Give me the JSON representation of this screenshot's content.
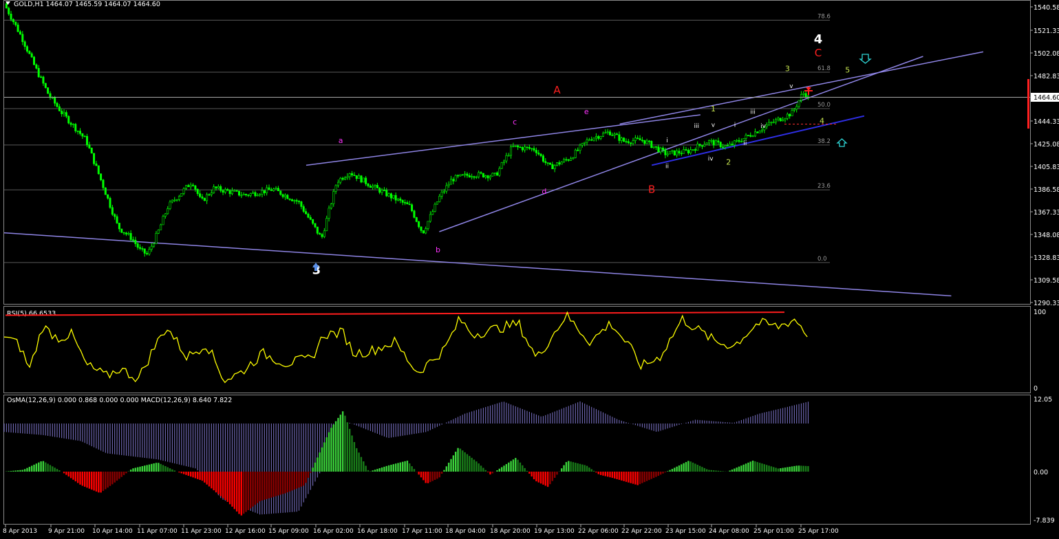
{
  "header": {
    "symbol_line": "GOLD,H1  1464.07 1465.59 1464.07 1464.60"
  },
  "colors": {
    "background": "#000000",
    "grid": "#5a5a5a",
    "candle": "#00ff00",
    "trendline": "#8f85e6",
    "trendline_dark": "#2f2fe8",
    "rsi_line": "#ffff00",
    "rsi_level": "#ff1d1d",
    "macd_line": "#8f85e6",
    "osma_up": "#3ad23a",
    "osma_down": "#ff0000",
    "osma_dark_down": "#8b0000",
    "osma_dark_up": "#197c19",
    "price_tag_bg": "#ffffff",
    "price_tag_fg": "#000000",
    "cursor_marker": "#ff0000"
  },
  "price_axis": {
    "ticks": [
      "1540.58",
      "1521.33",
      "1502.08",
      "1482.83",
      "1464.60",
      "1444.33",
      "1425.08",
      "1405.83",
      "1386.58",
      "1367.33",
      "1348.08",
      "1328.83",
      "1309.58",
      "1290.33"
    ],
    "current_price": "1464.60"
  },
  "time_axis": {
    "ticks": [
      "8 Apr 2013",
      "9 Apr 21:00",
      "10 Apr 14:00",
      "11 Apr 07:00",
      "11 Apr 23:00",
      "12 Apr 16:00",
      "15 Apr 09:00",
      "16 Apr 02:00",
      "16 Apr 18:00",
      "17 Apr 11:00",
      "18 Apr 04:00",
      "18 Apr 20:00",
      "19 Apr 13:00",
      "22 Apr 06:00",
      "22 Apr 22:00",
      "23 Apr 15:00",
      "24 Apr 08:00",
      "25 Apr 01:00",
      "25 Apr 17:00"
    ]
  },
  "fibonacci": {
    "levels": [
      {
        "label": "78.6",
        "price": 1530.6
      },
      {
        "label": "61.8",
        "price": 1485.2
      },
      {
        "label": "50.0",
        "price": 1453.4
      },
      {
        "label": "38.2",
        "price": 1421.7
      },
      {
        "label": "23.6",
        "price": 1382.5
      },
      {
        "label": "0.0",
        "price": 1319.1
      }
    ]
  },
  "wave_labels": [
    {
      "text": "3",
      "color": "#ffffff",
      "time": 24.4,
      "price": 1309.0,
      "size": "large"
    },
    {
      "text": "4",
      "color": "#ffffff",
      "time": 63.6,
      "price": 1510.5,
      "size": "large"
    },
    {
      "text": "C",
      "color": "#ff2020",
      "time": 63.6,
      "price": 1499.0,
      "size": "medium"
    },
    {
      "text": "A",
      "color": "#ff2020",
      "time": 43.2,
      "price": 1466.5,
      "size": "medium"
    },
    {
      "text": "B",
      "color": "#ff2020",
      "time": 50.6,
      "price": 1380.0,
      "size": "medium"
    },
    {
      "text": "a",
      "color": "#ff33ff",
      "time": 26.3,
      "price": 1423.5,
      "size": "small"
    },
    {
      "text": "b",
      "color": "#ff33ff",
      "time": 33.9,
      "price": 1328.0,
      "size": "small"
    },
    {
      "text": "c",
      "color": "#ff33ff",
      "time": 39.9,
      "price": 1439.5,
      "size": "small"
    },
    {
      "text": "d",
      "color": "#ff33ff",
      "time": 42.2,
      "price": 1379.0,
      "size": "small"
    },
    {
      "text": "e",
      "color": "#ff33ff",
      "time": 45.5,
      "price": 1448.5,
      "size": "small"
    },
    {
      "text": "1",
      "color": "#c8e650",
      "time": 55.4,
      "price": 1451.0,
      "size": "small"
    },
    {
      "text": "2",
      "color": "#c8e650",
      "time": 56.6,
      "price": 1404.5,
      "size": "small"
    },
    {
      "text": "3",
      "color": "#c8e650",
      "time": 61.2,
      "price": 1486.0,
      "size": "small"
    },
    {
      "text": "4",
      "color": "#c8e650",
      "time": 63.9,
      "price": 1440.5,
      "size": "small"
    },
    {
      "text": "5",
      "color": "#c8e650",
      "time": 65.9,
      "price": 1485.0,
      "size": "small"
    },
    {
      "text": "i",
      "color": "#ffffff",
      "time": 51.8,
      "price": 1424.0,
      "size": "tiny"
    },
    {
      "text": "ii",
      "color": "#ffffff",
      "time": 51.8,
      "price": 1401.5,
      "size": "tiny"
    },
    {
      "text": "iii",
      "color": "#ffffff",
      "time": 54.1,
      "price": 1436.5,
      "size": "tiny"
    },
    {
      "text": "iv",
      "color": "#ffffff",
      "time": 55.2,
      "price": 1408.0,
      "size": "tiny"
    },
    {
      "text": "v",
      "color": "#ffffff",
      "time": 55.4,
      "price": 1437.5,
      "size": "tiny"
    },
    {
      "text": "i",
      "color": "#ffffff",
      "time": 57.1,
      "price": 1437.5,
      "size": "tiny"
    },
    {
      "text": "ii",
      "color": "#ffffff",
      "time": 57.9,
      "price": 1421.5,
      "size": "tiny"
    },
    {
      "text": "iii",
      "color": "#ffffff",
      "time": 58.5,
      "price": 1449.0,
      "size": "tiny"
    },
    {
      "text": "iv",
      "color": "#ffffff",
      "time": 59.3,
      "price": 1436.5,
      "size": "tiny"
    },
    {
      "text": "v",
      "color": "#ffffff",
      "time": 61.5,
      "price": 1471.5,
      "size": "tiny"
    }
  ],
  "rsi_panel": {
    "label": "RSI(5) 66.6533",
    "scale_max": "100",
    "scale_min": "0"
  },
  "osma_panel": {
    "label": "OsMA(12,26,9) 0.000 0.868 0.000 0.000  MACD(12,26,9) 8.640 7.822",
    "scale_top": "12.05",
    "scale_mid": "0.00",
    "scale_bottom": "-7.839"
  },
  "chart_data": {
    "type": "candlestick",
    "title": "GOLD,H1",
    "x_unit": "bars since 8 Apr 2013 (1 bar = 1 hour)",
    "ylim": [
      1283,
      1547
    ],
    "ohlc_current": {
      "open": 1464.07,
      "high": 1465.59,
      "low": 1464.07,
      "close": 1464.6
    },
    "close_path": [
      [
        0,
        1545
      ],
      [
        1.4,
        1515
      ],
      [
        2.4,
        1490
      ],
      [
        3.5,
        1465
      ],
      [
        4.5,
        1450
      ],
      [
        6.4,
        1426
      ],
      [
        7.6,
        1390
      ],
      [
        8.9,
        1350
      ],
      [
        10.0,
        1340
      ],
      [
        10.6,
        1330
      ],
      [
        11.2,
        1326
      ],
      [
        12.0,
        1345
      ],
      [
        12.8,
        1368
      ],
      [
        14.7,
        1390
      ],
      [
        15.4,
        1372
      ],
      [
        16.4,
        1384
      ],
      [
        18.8,
        1378
      ],
      [
        21.0,
        1383
      ],
      [
        23.0,
        1372
      ],
      [
        24.8,
        1340
      ],
      [
        26.0,
        1390
      ],
      [
        27.0,
        1398
      ],
      [
        28.7,
        1386
      ],
      [
        30.5,
        1375
      ],
      [
        31.7,
        1368
      ],
      [
        32.7,
        1345
      ],
      [
        34.0,
        1376
      ],
      [
        35.0,
        1392
      ],
      [
        36.5,
        1396
      ],
      [
        38.4,
        1395
      ],
      [
        39.7,
        1420
      ],
      [
        41.5,
        1418
      ],
      [
        42.6,
        1402
      ],
      [
        44.2,
        1410
      ],
      [
        45.7,
        1427
      ],
      [
        47.3,
        1433
      ],
      [
        48.4,
        1425
      ],
      [
        49.9,
        1426
      ],
      [
        51.7,
        1414
      ],
      [
        53.4,
        1416
      ],
      [
        55.0,
        1425
      ],
      [
        56.5,
        1420
      ],
      [
        58.2,
        1430
      ],
      [
        59.8,
        1440
      ],
      [
        61.6,
        1450
      ],
      [
        62.4,
        1467
      ],
      [
        62.9,
        1465
      ]
    ],
    "trendlines": [
      {
        "name": "lower channel",
        "from": [
          0,
          1345
        ],
        "to": [
          74,
          1290
        ]
      },
      {
        "name": "a-c-e line",
        "from": [
          23.6,
          1404
        ],
        "to": [
          54.4,
          1448
        ]
      },
      {
        "name": "b-d line",
        "from": [
          34.0,
          1346
        ],
        "to": [
          71.8,
          1499
        ]
      },
      {
        "name": "upper channel",
        "from": [
          48.1,
          1440
        ],
        "to": [
          76.5,
          1503
        ]
      },
      {
        "name": "wave-4 support",
        "from": [
          50.6,
          1404
        ],
        "to": [
          67.2,
          1447
        ],
        "color": "dark"
      }
    ],
    "rsi": {
      "period": 5,
      "last": 66.6533,
      "ylim": [
        0,
        100
      ],
      "path": [
        [
          0,
          70
        ],
        [
          1.2,
          55
        ],
        [
          2.0,
          25
        ],
        [
          3.0,
          80
        ],
        [
          4.2,
          65
        ],
        [
          5.3,
          70
        ],
        [
          6.4,
          30
        ],
        [
          8.0,
          15
        ],
        [
          9.0,
          25
        ],
        [
          10.5,
          12
        ],
        [
          11.8,
          55
        ],
        [
          12.7,
          80
        ],
        [
          14.3,
          40
        ],
        [
          15.8,
          58
        ],
        [
          17.2,
          10
        ],
        [
          18.5,
          20
        ],
        [
          20.2,
          45
        ],
        [
          22.0,
          32
        ],
        [
          24.0,
          38
        ],
        [
          25.0,
          70
        ],
        [
          26.5,
          72
        ],
        [
          27.3,
          45
        ],
        [
          28.6,
          48
        ],
        [
          30.5,
          60
        ],
        [
          32.3,
          20
        ],
        [
          34.4,
          50
        ],
        [
          35.6,
          90
        ],
        [
          36.6,
          70
        ],
        [
          38.6,
          78
        ],
        [
          40.2,
          84
        ],
        [
          41.6,
          38
        ],
        [
          43.9,
          95
        ],
        [
          45.8,
          60
        ],
        [
          47.4,
          85
        ],
        [
          48.8,
          55
        ],
        [
          49.8,
          28
        ],
        [
          51.2,
          40
        ],
        [
          53.0,
          90
        ],
        [
          55.6,
          60
        ],
        [
          57.0,
          55
        ],
        [
          58.9,
          85
        ],
        [
          60.5,
          80
        ],
        [
          61.8,
          90
        ],
        [
          62.9,
          67
        ]
      ]
    },
    "macd": {
      "fast": 12,
      "slow": 26,
      "signal": 9,
      "macd_last": 8.64,
      "signal_last": 7.822,
      "ylim": [
        -7.839,
        12.05
      ],
      "macd_path": [
        [
          0,
          6.5
        ],
        [
          3.0,
          6.0
        ],
        [
          6.0,
          5.0
        ],
        [
          8.0,
          3.0
        ],
        [
          12.0,
          2.0
        ],
        [
          15.0,
          0.5
        ],
        [
          17.0,
          -4.5
        ],
        [
          20.0,
          -7.0
        ],
        [
          23.0,
          -6.5
        ],
        [
          25.0,
          1.0
        ],
        [
          27.0,
          8.0
        ],
        [
          30.0,
          5.5
        ],
        [
          33.0,
          6.5
        ],
        [
          36.0,
          9.5
        ],
        [
          39.0,
          11.5
        ],
        [
          42.0,
          9.0
        ],
        [
          45.0,
          11.5
        ],
        [
          48.0,
          8.5
        ],
        [
          51.0,
          6.5
        ],
        [
          54.0,
          8.5
        ],
        [
          57.0,
          8.0
        ],
        [
          59.0,
          9.5
        ],
        [
          61.0,
          10.5
        ],
        [
          62.9,
          11.5
        ]
      ],
      "osma_path": [
        [
          0,
          0.0
        ],
        [
          1.5,
          0.3
        ],
        [
          3.0,
          1.8
        ],
        [
          4.5,
          0.0
        ],
        [
          6.0,
          -2.2
        ],
        [
          7.5,
          -3.5
        ],
        [
          8.5,
          -2.0
        ],
        [
          10.0,
          0.5
        ],
        [
          12.0,
          1.5
        ],
        [
          13.5,
          0.0
        ],
        [
          15.5,
          -1.5
        ],
        [
          17.5,
          -5.0
        ],
        [
          18.5,
          -7.2
        ],
        [
          20.0,
          -4.8
        ],
        [
          22.0,
          -3.5
        ],
        [
          23.5,
          -2.2
        ],
        [
          25.5,
          7.0
        ],
        [
          26.5,
          10.0
        ],
        [
          27.5,
          4.0
        ],
        [
          28.5,
          0.0
        ],
        [
          30.0,
          1.0
        ],
        [
          31.5,
          1.8
        ],
        [
          33.0,
          -2.0
        ],
        [
          34.0,
          -1.0
        ],
        [
          35.5,
          4.0
        ],
        [
          37.0,
          1.5
        ],
        [
          38.0,
          -0.5
        ],
        [
          40.0,
          2.3
        ],
        [
          41.5,
          -1.5
        ],
        [
          42.5,
          -2.5
        ],
        [
          44.0,
          1.8
        ],
        [
          45.5,
          1.0
        ],
        [
          46.5,
          -0.5
        ],
        [
          47.5,
          -1.0
        ],
        [
          49.5,
          -2.2
        ],
        [
          51.0,
          -0.8
        ],
        [
          53.5,
          1.8
        ],
        [
          55.0,
          0.3
        ],
        [
          56.5,
          0.0
        ],
        [
          58.5,
          1.8
        ],
        [
          60.5,
          0.5
        ],
        [
          62.0,
          1.0
        ],
        [
          62.9,
          0.9
        ]
      ]
    }
  }
}
